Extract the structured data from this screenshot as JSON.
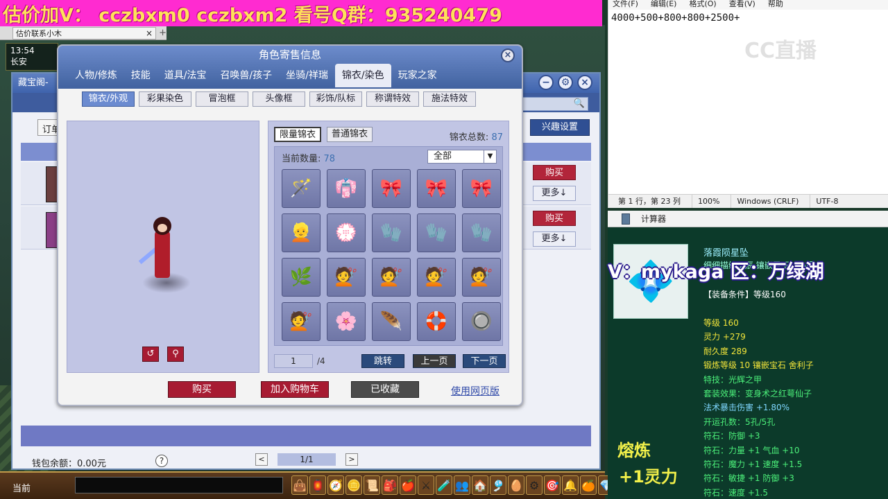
{
  "banner": {
    "text": "估价加V：  cczbxm0   cczbxm2   看号Q群：935240479"
  },
  "browser_tab": {
    "title": "估价联系小木",
    "close": "×",
    "plus": "+"
  },
  "hud": {
    "time": "13:54",
    "place": "长安"
  },
  "cbg": {
    "title": "藏宝阁-",
    "order_label": "订单",
    "interest_label": "兴趣设置",
    "buy_label": "购买",
    "more_label": "更多↓",
    "wallet": "钱包余额：0.00元",
    "help": "?",
    "page": "1/1",
    "prev": "<",
    "next": ">"
  },
  "dialog": {
    "title": "角色寄售信息",
    "close": "×",
    "main_tabs": [
      "人物/修炼",
      "技能",
      "道具/法宝",
      "召唤兽/孩子",
      "坐骑/祥瑞",
      "锦衣/染色",
      "玩家之家"
    ],
    "active_main_tab": 5,
    "sub_tabs": [
      "锦衣/外观",
      "彩果染色",
      "冒泡框",
      "头像框",
      "彩饰/队标",
      "称谓特效",
      "施法特效"
    ],
    "active_sub_tab": 0,
    "rotate": "↺",
    "pose": "⚲",
    "wardrobe": {
      "tabs": [
        "限量锦衣",
        "普通锦衣"
      ],
      "active_tab": 0,
      "total_label": "锦衣总数:",
      "total": "87",
      "count_label": "当前数量:",
      "count": "78",
      "filter": "全部",
      "filter_arrow": "▼",
      "items": [
        "🪄",
        "👘",
        "🎀",
        "🎀",
        "🎀",
        "👱",
        "💮",
        "🧤",
        "🧤",
        "🧤",
        "🌿",
        "💇",
        "💇",
        "💇",
        "💇",
        "💇",
        "🌸",
        "🪶",
        "🛟",
        "🔘"
      ],
      "page": "1",
      "page_total": "/4",
      "jump": "跳转",
      "prev": "上一页",
      "next": "下一页"
    },
    "actions": {
      "buy": "购买",
      "cart": "加入购物车",
      "favorited": "已收藏",
      "web": "使用网页版"
    }
  },
  "game_taskbar": {
    "label": "当前"
  },
  "game_icons": [
    "👜",
    "🏮",
    "🧭",
    "🪙",
    "📜",
    "🎒",
    "🍎",
    "⚔",
    "🧪",
    "👥",
    "🏠",
    "🎐",
    "🥚",
    "⚙",
    "🎯",
    "🔔",
    "🍊",
    "💎",
    "🐉"
  ],
  "notepad": {
    "menu": [
      "文件(F)",
      "编辑(E)",
      "格式(O)",
      "查看(V)",
      "帮助"
    ],
    "content": "4000+500+800+800+2500+",
    "watermark": "CC直播",
    "status": [
      "第 1 行，第 23 列",
      "100%",
      "Windows (CRLF)",
      "UTF-8"
    ]
  },
  "calculator": {
    "title": "计算器"
  },
  "item": {
    "name": "落霞陨星坠",
    "icon": "💠",
    "desc": "细细描绘星辰 镶嵌灵玉，心愿。",
    "req": "【装备条件】等级160",
    "stats": [
      {
        "text": "等级 160",
        "cls": "y"
      },
      {
        "text": "灵力 +279",
        "cls": "y"
      },
      {
        "text": "耐久度 289",
        "cls": "y"
      },
      {
        "text": "锻炼等级 10  镶嵌宝石 舍利子",
        "cls": "y"
      },
      {
        "text": "特技：光辉之甲",
        "cls": "g"
      },
      {
        "text": "套装效果：变身术之红萼仙子",
        "cls": "g"
      },
      {
        "text": "法术暴击伤害 +1.80%",
        "cls": "c"
      },
      {
        "text": "开运孔数：5孔/5孔",
        "cls": "g"
      },
      {
        "text": "符石：防御 +3",
        "cls": "g"
      },
      {
        "text": "符石：力量 +1 气血 +10",
        "cls": "g"
      },
      {
        "text": "符石：魔力 +1 速度 +1.5",
        "cls": "g"
      },
      {
        "text": "符石：敏捷 +1 防御 +3",
        "cls": "g"
      },
      {
        "text": "符石：速度 +1.5",
        "cls": "g"
      }
    ],
    "overlay": "V：mykaga  区：万绿湖",
    "smelt_title": "熔炼",
    "smelt_value": "+1灵力"
  }
}
